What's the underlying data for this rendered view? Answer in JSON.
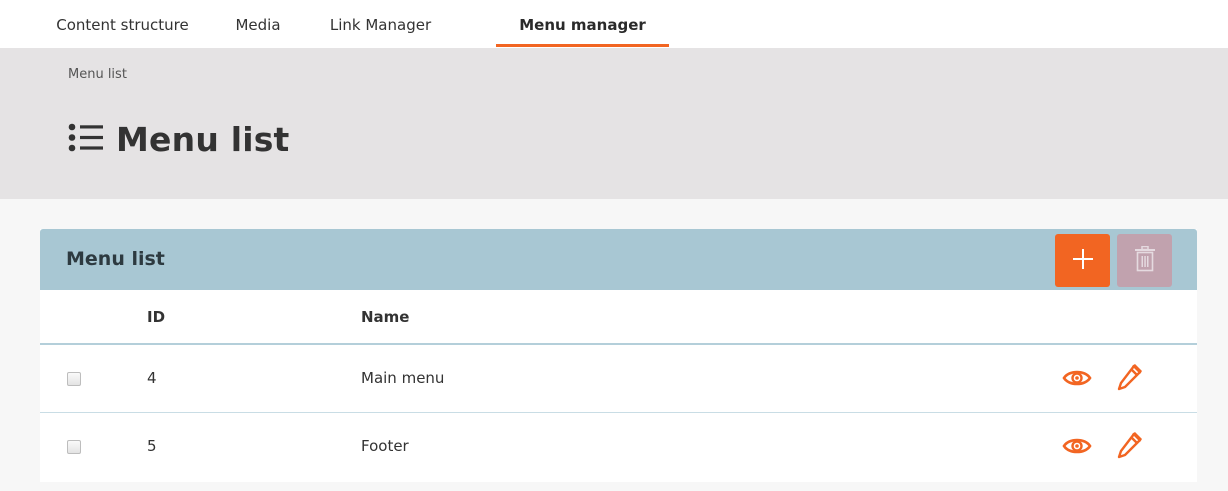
{
  "nav": {
    "tabs": [
      {
        "label": "Content structure"
      },
      {
        "label": "Media"
      },
      {
        "label": "Link Manager"
      },
      {
        "label": "Menu manager",
        "active": true
      }
    ]
  },
  "header": {
    "breadcrumb": "Menu list",
    "title": "Menu list",
    "title_icon": "list-icon"
  },
  "panel": {
    "title": "Menu list",
    "add_icon": "plus-icon",
    "delete_icon": "trash-icon",
    "columns": [
      "ID",
      "Name"
    ],
    "rows": [
      {
        "id": "4",
        "name": "Main menu"
      },
      {
        "id": "5",
        "name": "Footer"
      }
    ],
    "row_actions": [
      "eye-icon",
      "pencil-icon"
    ]
  },
  "colors": {
    "accent": "#f26522",
    "header_bg": "#e5e3e4",
    "panel_head_bg": "#a8c7d3",
    "delete_disabled": "#c3a1ad"
  }
}
